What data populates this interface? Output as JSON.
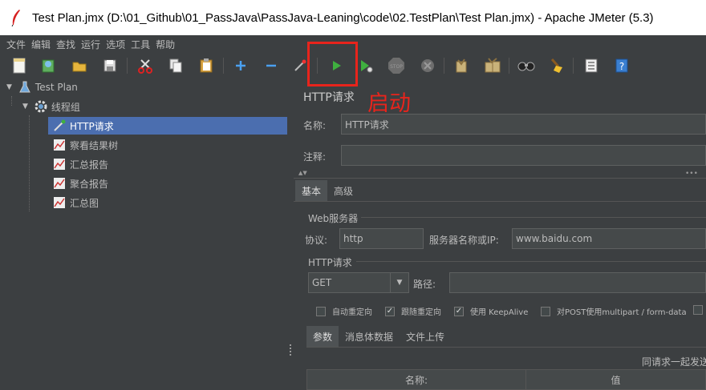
{
  "window": {
    "title": "Test Plan.jmx (D:\\01_Github\\01_PassJava\\PassJava-Leaning\\code\\02.TestPlan\\Test Plan.jmx) - Apache JMeter (5.3)"
  },
  "menu": [
    "文件",
    "编辑",
    "查找",
    "运行",
    "选项",
    "工具",
    "帮助"
  ],
  "toolbar": {
    "icons": [
      "new-icon",
      "templates-icon",
      "open-icon",
      "save-icon",
      "cut-icon",
      "copy-icon",
      "paste-icon",
      "expand-icon",
      "collapse-icon",
      "toggle-icon",
      "start-icon",
      "start-no-pause-icon",
      "stop-icon",
      "shutdown-icon",
      "clear-icon",
      "clear-all-icon",
      "search-icon",
      "reset-search-icon",
      "function-helper-icon",
      "help-icon"
    ]
  },
  "annotation": {
    "label": "启动",
    "color": "#e8241c"
  },
  "tree": {
    "root": "Test Plan",
    "thread_group": "线程组",
    "items": [
      "HTTP请求",
      "察看结果树",
      "汇总报告",
      "聚合报告",
      "汇总图"
    ],
    "selected": "HTTP请求"
  },
  "panel": {
    "heading": "HTTP请求",
    "name_label": "名称:",
    "name_value": "HTTP请求",
    "comment_label": "注释:",
    "comment_value": "",
    "tabs": [
      "基本",
      "高级"
    ],
    "web_server": {
      "group": "Web服务器",
      "protocol_label": "协议:",
      "protocol_value": "http",
      "server_label": "服务器名称或IP:",
      "server_value": "www.baidu.com"
    },
    "http_request": {
      "group": "HTTP请求",
      "method": "GET",
      "path_label": "路径:",
      "path_value": ""
    },
    "options": [
      {
        "label": "自动重定向",
        "checked": false
      },
      {
        "label": "跟随重定向",
        "checked": true
      },
      {
        "label": "使用 KeepAlive",
        "checked": true
      },
      {
        "label": "对POST使用multipart / form-data",
        "checked": false
      }
    ],
    "sub_tabs": [
      "参数",
      "消息体数据",
      "文件上传"
    ],
    "send_with_request": "同请求一起发送",
    "table_headers": [
      "名称:",
      "值"
    ]
  }
}
